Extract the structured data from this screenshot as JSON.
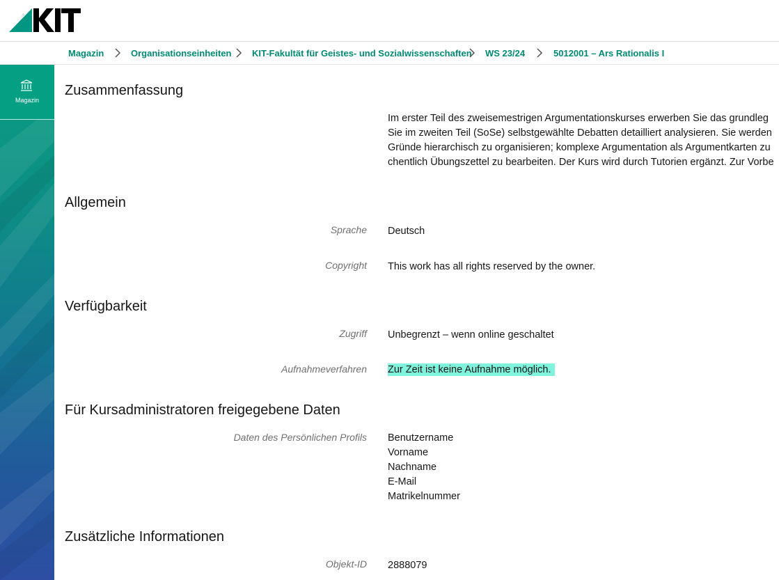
{
  "header": {
    "logo_text": "KIT"
  },
  "breadcrumb": {
    "items": [
      "Magazin",
      "Organisationseinheiten",
      "KIT-Fakultät für Geistes- und Sozialwissenschaften",
      "WS 23/24",
      "5012001 – Ars Rationalis I"
    ]
  },
  "sidebar": {
    "items": [
      {
        "label": "Magazin",
        "icon": "library-icon"
      }
    ]
  },
  "colors": {
    "accent": "#008b72",
    "highlight": "#7ff3dc",
    "sidebar_top": "#0a9f80",
    "sidebar_bottom": "#2d4ea3"
  },
  "sections": {
    "summary": {
      "title": "Zusammenfassung",
      "lines": [
        "Im erster Teil des zweisemestrigen Argumentationskurses erwerben Sie das grundleg",
        "Sie im zweiten Teil (SoSe) selbstgewählte Debatten detailliert analysieren. Sie werden",
        "Gründe hierarchisch zu organisieren; komplexe Argumentation als Argumentkarten zu",
        "chentlich Übungszettel zu bearbeiten. Der Kurs wird durch Tutorien ergänzt. Zur Vorbe"
      ]
    },
    "general": {
      "title": "Allgemein",
      "language_label": "Sprache",
      "language_value": "Deutsch",
      "copyright_label": "Copyright",
      "copyright_value": "This work has all rights reserved by the owner."
    },
    "availability": {
      "title": "Verfügbarkeit",
      "access_label": "Zugriff",
      "access_value": "Unbegrenzt – wenn online geschaltet",
      "admission_label": "Aufnahmeverfahren",
      "admission_value": "Zur Zeit ist keine Aufnahme möglich."
    },
    "admin_data": {
      "title": "Für Kursadministratoren freigegebene Daten",
      "profile_label": "Daten des Persönlichen Profils",
      "profile_fields": [
        "Benutzername",
        "Vorname",
        "Nachname",
        "E-Mail",
        "Matrikelnummer"
      ]
    },
    "additional": {
      "title": "Zusätzliche Informationen",
      "object_id_label": "Objekt-ID",
      "object_id_value": "2888079"
    }
  }
}
